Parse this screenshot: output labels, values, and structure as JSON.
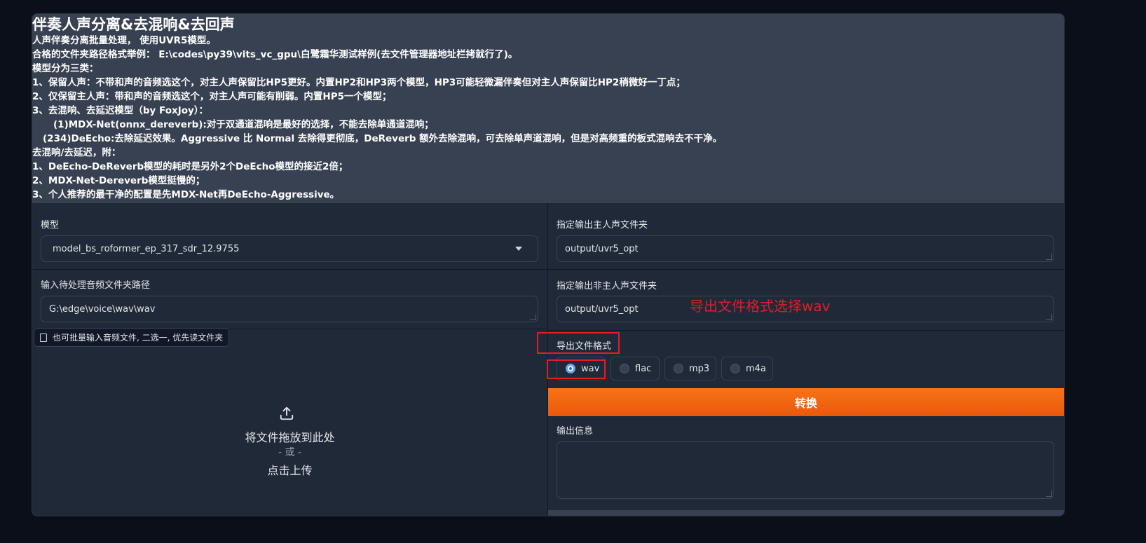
{
  "header": {
    "title": "伴奏人声分离&去混响&去回声",
    "lines": [
      "人声伴奏分离批量处理， 使用UVR5模型。",
      "合格的文件夹路径格式举例： E:\\codes\\py39\\vits_vc_gpu\\白鹭霜华测试样例(去文件管理器地址栏拷就行了)。",
      "模型分为三类：",
      "1、保留人声：不带和声的音频选这个，对主人声保留比HP5更好。内置HP2和HP3两个模型，HP3可能轻微漏伴奏但对主人声保留比HP2稍微好一丁点；",
      "2、仅保留主人声：带和声的音频选这个，对主人声可能有削弱。内置HP5一个模型；",
      "3、去混响、去延迟模型（by FoxJoy）：",
      "(1)MDX-Net(onnx_dereverb):对于双通道混响是最好的选择，不能去除单通道混响；",
      "(234)DeEcho:去除延迟效果。Aggressive 比 Normal 去除得更彻底，DeReverb 额外去除混响，可去除单声道混响，但是对高频重的板式混响去不干净。",
      "去混响/去延迟，附：",
      "1、DeEcho-DeReverb模型的耗时是另外2个DeEcho模型的接近2倍；",
      "2、MDX-Net-Dereverb模型挺慢的；",
      "3、个人推荐的最干净的配置是先MDX-Net再DeEcho-Aggressive。"
    ]
  },
  "left": {
    "model_label": "模型",
    "model_value": "model_bs_roformer_ep_317_sdr_12.9755",
    "input_dir_label": "输入待处理音频文件夹路径",
    "input_dir_value": "G:\\edge\\voice\\wav\\wav",
    "hint": "也可批量输入音频文件, 二选一, 优先读文件夹",
    "drop_main": "将文件拖放到此处",
    "drop_or": "- 或 -",
    "drop_click": "点击上传"
  },
  "right": {
    "vocal_out_label": "指定输出主人声文件夹",
    "vocal_out_value": "output/uvr5_opt",
    "inst_out_label": "指定输出非主人声文件夹",
    "inst_out_value": "output/uvr5_opt",
    "format_label": "导出文件格式",
    "formats": [
      "wav",
      "flac",
      "mp3",
      "m4a"
    ],
    "selected_format": "wav",
    "convert_label": "转换",
    "output_info_label": "输出信息",
    "output_info_value": ""
  },
  "annotation": {
    "text": "导出文件格式选择wav",
    "color": "#e11d2a"
  },
  "icons": {
    "dropdown": "chevron-down-icon",
    "upload": "upload-icon",
    "file": "file-icon"
  }
}
